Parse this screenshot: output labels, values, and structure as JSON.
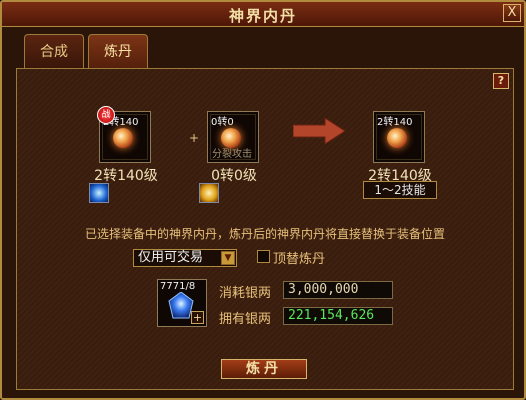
{
  "window": {
    "title": "神界内丹",
    "close_label": "X"
  },
  "tabs": [
    {
      "label": "合成",
      "active": false
    },
    {
      "label": "炼丹",
      "active": true
    }
  ],
  "help_label": "?",
  "slots": {
    "left": {
      "level_text": "2转140",
      "caption": "2转140级",
      "badge": "战"
    },
    "middle": {
      "level_text": "0转0",
      "watermark": "分裂攻击",
      "caption": "0转0级"
    },
    "result": {
      "level_text": "2转140",
      "caption": "2转140级",
      "skill_range": "1～2技能"
    }
  },
  "plus_symbol": "+",
  "info_text": "已选择装备中的神界内丹，炼丹后的神界内丹将直接替换于装备位置",
  "trade_select": {
    "value": "仅用可交易"
  },
  "replace_checkbox": {
    "label": "顶替炼丹",
    "checked": false
  },
  "material": {
    "count_text": "7771/8"
  },
  "cost": {
    "label": "消耗银两",
    "value": "3,000,000"
  },
  "own": {
    "label": "拥有银两",
    "value": "221,154,626"
  },
  "refine_button_label": "炼丹",
  "colors": {
    "accent_gold": "#b08a3e",
    "own_money_green": "#58e85a",
    "panel_brown": "#3b1d0d"
  }
}
